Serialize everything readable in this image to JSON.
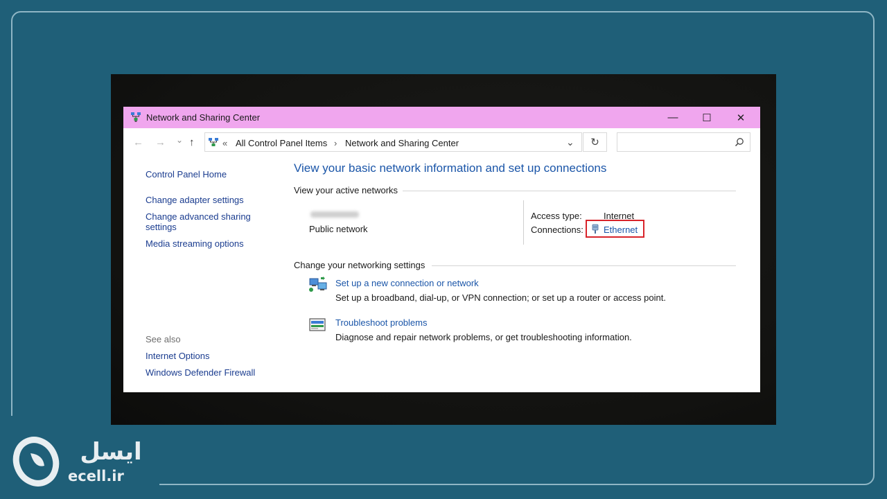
{
  "window": {
    "title": "Network and Sharing Center",
    "controls": {
      "minimize": "—",
      "maximize": "☐",
      "close": "✕"
    }
  },
  "addressbar": {
    "back": "←",
    "forward": "→",
    "recent": "⌄",
    "up": "↑",
    "chevrons": "«",
    "crumb1": "All Control Panel Items",
    "separator": "›",
    "crumb2": "Network and Sharing Center",
    "dropdown": "⌄",
    "refresh": "↻",
    "search_placeholder": ""
  },
  "sidebar": {
    "items": [
      "Control Panel Home",
      "Change adapter settings",
      "Change advanced sharing",
      "settings",
      "Media streaming options"
    ],
    "see_also_label": "See also",
    "see_also": [
      "Internet Options",
      "Windows Defender Firewall"
    ]
  },
  "main": {
    "heading": "View your basic network information and set up connections",
    "active_networks_label": "View your active networks",
    "network": {
      "type": "Public network",
      "access_type_label": "Access type:",
      "access_type_value": "Internet",
      "connections_label": "Connections:",
      "connection_name": "Ethernet"
    },
    "change_settings_label": "Change your networking settings",
    "tasks": [
      {
        "link": "Set up a new connection or network",
        "description": "Set up a broadband, dial-up, or VPN connection; or set up a router or access point."
      },
      {
        "link": "Troubleshoot problems",
        "description": "Diagnose and repair network problems, or get troubleshooting information."
      }
    ]
  },
  "branding": {
    "name_fa": "ایسل",
    "domain": "ecell.ir"
  },
  "colors": {
    "background": "#1f5f78",
    "titlebar": "#f0a6ee",
    "link": "#1a55a8",
    "highlight": "#d8232a"
  }
}
